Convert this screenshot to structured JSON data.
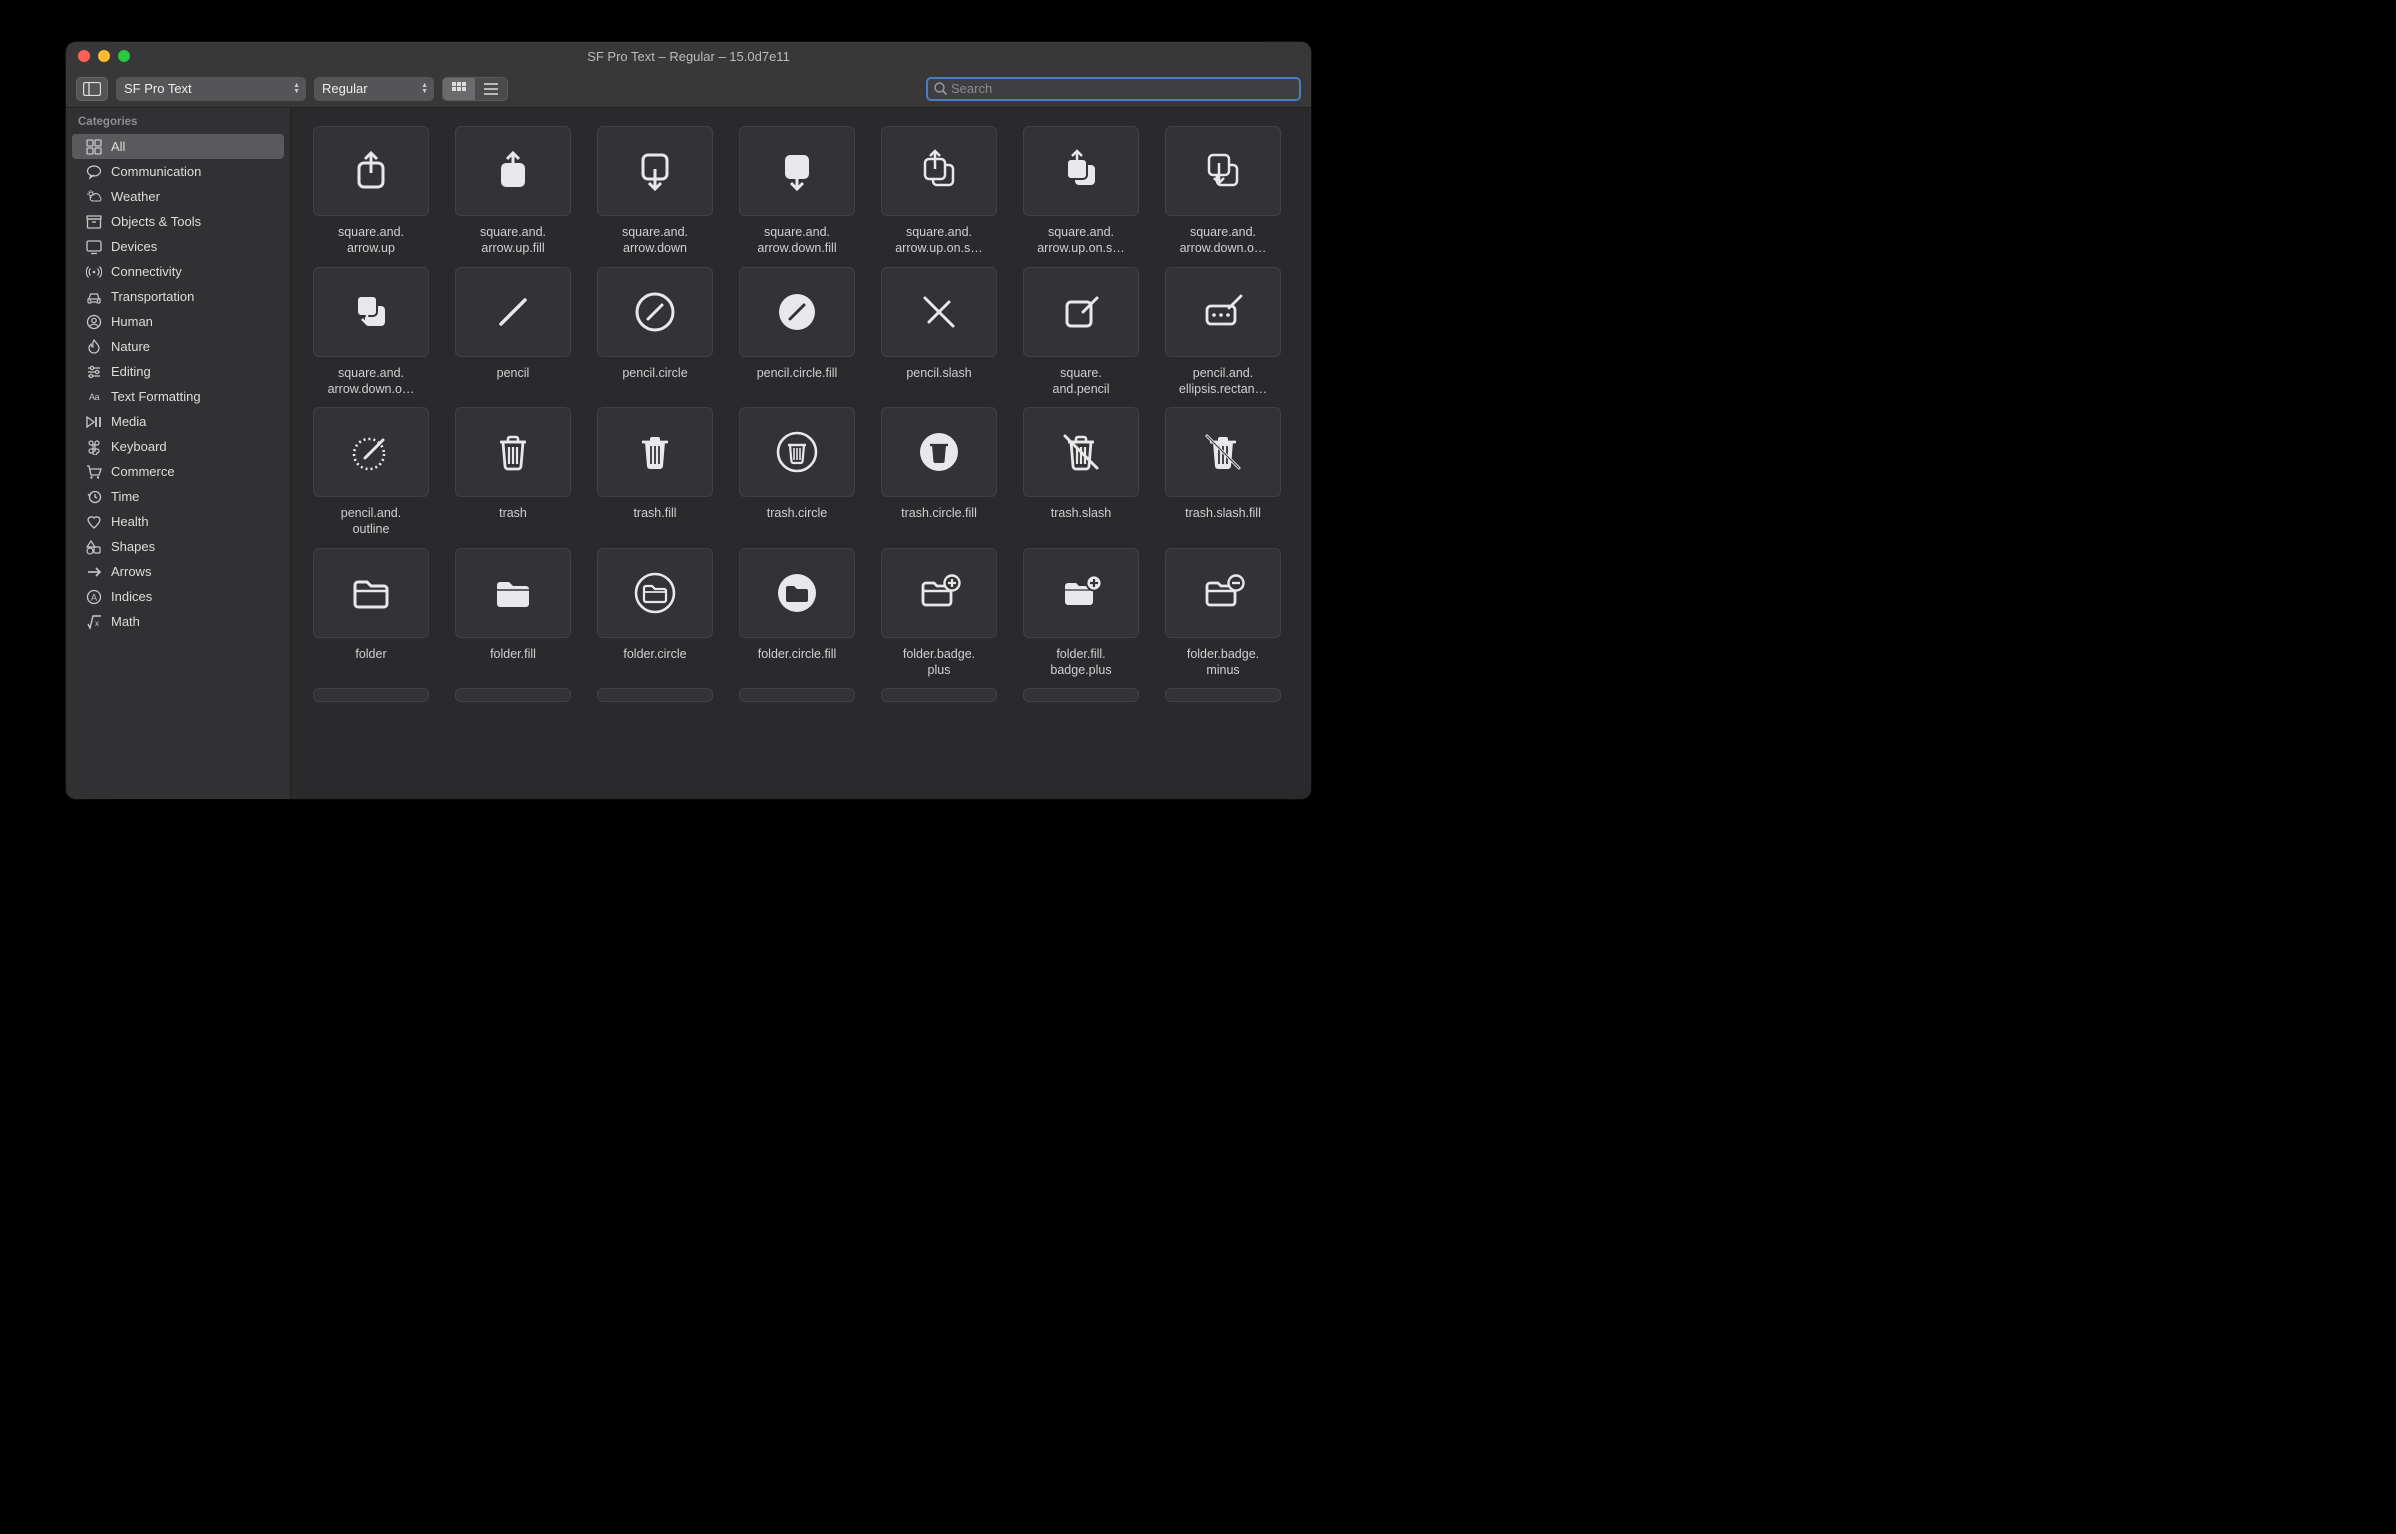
{
  "window": {
    "title": "SF Pro Text – Regular – 15.0d7e11"
  },
  "toolbar": {
    "font_select": "SF Pro Text",
    "weight_select": "Regular",
    "search_placeholder": "Search"
  },
  "sidebar": {
    "heading": "Categories",
    "categories": [
      {
        "label": "All",
        "icon": "grid",
        "selected": true
      },
      {
        "label": "Communication",
        "icon": "bubble"
      },
      {
        "label": "Weather",
        "icon": "cloud-sun"
      },
      {
        "label": "Objects & Tools",
        "icon": "archivebox"
      },
      {
        "label": "Devices",
        "icon": "display"
      },
      {
        "label": "Connectivity",
        "icon": "antenna"
      },
      {
        "label": "Transportation",
        "icon": "car"
      },
      {
        "label": "Human",
        "icon": "person-crop"
      },
      {
        "label": "Nature",
        "icon": "flame"
      },
      {
        "label": "Editing",
        "icon": "sliders"
      },
      {
        "label": "Text Formatting",
        "icon": "textformat"
      },
      {
        "label": "Media",
        "icon": "playpause"
      },
      {
        "label": "Keyboard",
        "icon": "command"
      },
      {
        "label": "Commerce",
        "icon": "cart"
      },
      {
        "label": "Time",
        "icon": "clock-arrow"
      },
      {
        "label": "Health",
        "icon": "heart"
      },
      {
        "label": "Shapes",
        "icon": "shapes"
      },
      {
        "label": "Arrows",
        "icon": "arrow-right"
      },
      {
        "label": "Indices",
        "icon": "a-circle"
      },
      {
        "label": "Math",
        "icon": "root"
      }
    ]
  },
  "symbols": [
    {
      "name": "square.and.arrow.up",
      "icon": "share-up"
    },
    {
      "name": "square.and.arrow.up.fill",
      "icon": "share-up-fill"
    },
    {
      "name": "square.and.arrow.down",
      "icon": "share-down"
    },
    {
      "name": "square.and.arrow.down.fill",
      "icon": "share-down-fill"
    },
    {
      "name": "square.and.arrow.up.on.square",
      "icon": "share-up-on-square"
    },
    {
      "name": "square.and.arrow.up.on.square.fill",
      "icon": "share-up-on-square-fill"
    },
    {
      "name": "square.and.arrow.down.on.square",
      "icon": "share-down-on-square"
    },
    {
      "name": "square.and.arrow.down.on.square.fill",
      "icon": "share-down-on-square-fill"
    },
    {
      "name": "pencil",
      "icon": "pencil"
    },
    {
      "name": "pencil.circle",
      "icon": "pencil-circle"
    },
    {
      "name": "pencil.circle.fill",
      "icon": "pencil-circle-fill"
    },
    {
      "name": "pencil.slash",
      "icon": "pencil-slash"
    },
    {
      "name": "square.and.pencil",
      "icon": "square-and-pencil"
    },
    {
      "name": "pencil.and.ellipsis.rectangle",
      "icon": "pencil-ellipsis-rect"
    },
    {
      "name": "pencil.and.outline",
      "icon": "pencil-and-outline"
    },
    {
      "name": "trash",
      "icon": "trash"
    },
    {
      "name": "trash.fill",
      "icon": "trash-fill"
    },
    {
      "name": "trash.circle",
      "icon": "trash-circle"
    },
    {
      "name": "trash.circle.fill",
      "icon": "trash-circle-fill"
    },
    {
      "name": "trash.slash",
      "icon": "trash-slash"
    },
    {
      "name": "trash.slash.fill",
      "icon": "trash-slash-fill"
    },
    {
      "name": "folder",
      "icon": "folder"
    },
    {
      "name": "folder.fill",
      "icon": "folder-fill"
    },
    {
      "name": "folder.circle",
      "icon": "folder-circle"
    },
    {
      "name": "folder.circle.fill",
      "icon": "folder-circle-fill"
    },
    {
      "name": "folder.badge.plus",
      "icon": "folder-badge-plus"
    },
    {
      "name": "folder.fill.badge.plus",
      "icon": "folder-fill-badge-plus"
    },
    {
      "name": "folder.badge.minus",
      "icon": "folder-badge-minus"
    }
  ],
  "symbol_display_labels": [
    "square.and.\narrow.up",
    "square.and.\narrow.up.fill",
    "square.and.\narrow.down",
    "square.and.\narrow.down.fill",
    "square.and.\narrow.up.on.s…",
    "square.and.\narrow.up.on.s…",
    "square.and.\narrow.down.o…",
    "square.and.\narrow.down.o…",
    "pencil",
    "pencil.circle",
    "pencil.circle.fill",
    "pencil.slash",
    "square.\nand.pencil",
    "pencil.and.\nellipsis.rectan…",
    "pencil.and.\noutline",
    "trash",
    "trash.fill",
    "trash.circle",
    "trash.circle.fill",
    "trash.slash",
    "trash.slash.fill",
    "folder",
    "folder.fill",
    "folder.circle",
    "folder.circle.fill",
    "folder.badge.\nplus",
    "folder.fill.\nbadge.plus",
    "folder.badge.\nminus"
  ]
}
